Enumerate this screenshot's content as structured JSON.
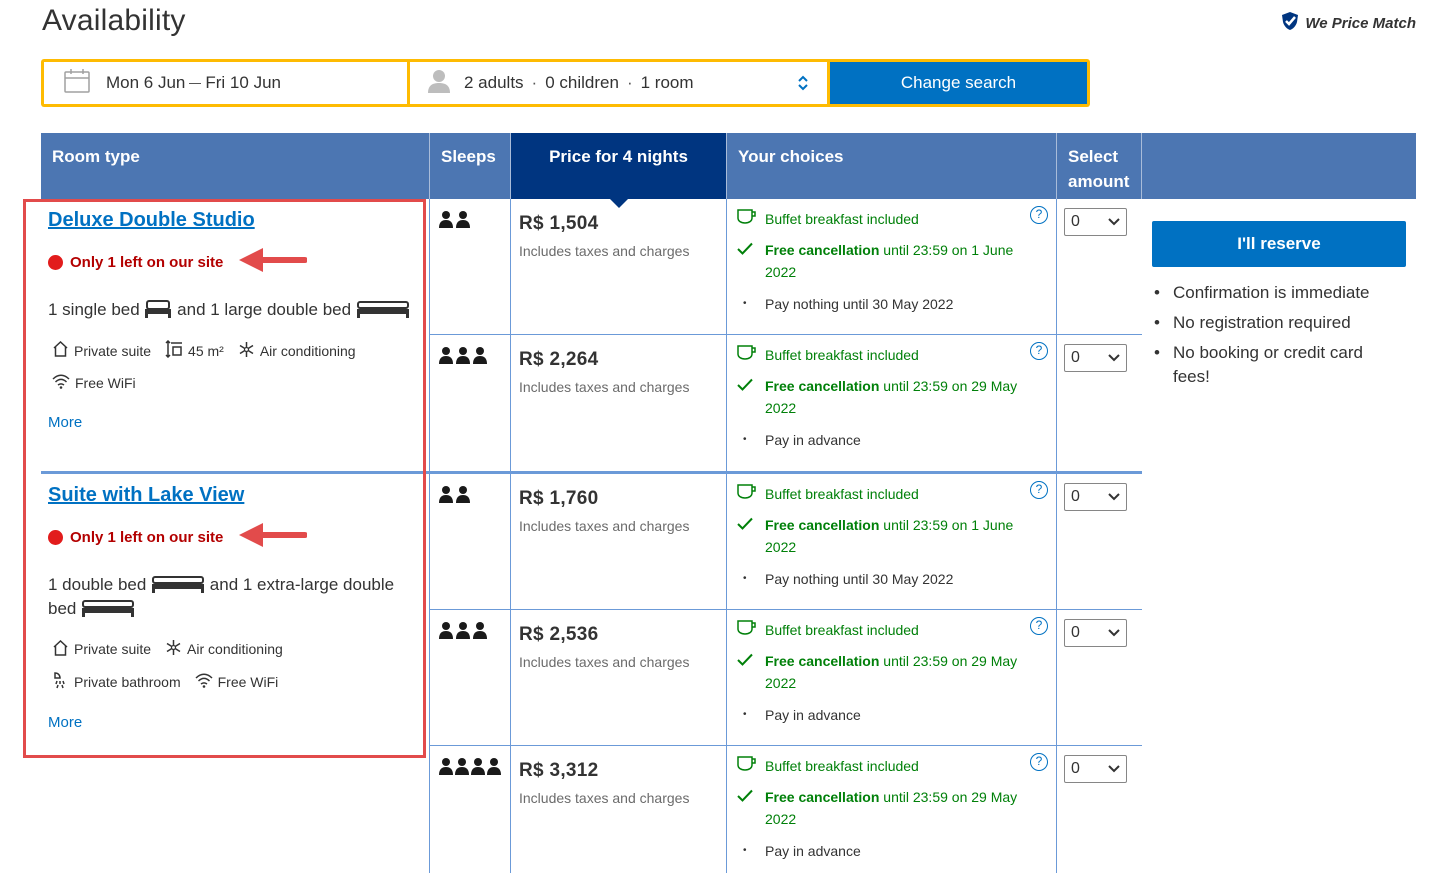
{
  "page": {
    "title": "Availability",
    "price_match": "We Price Match"
  },
  "search": {
    "date_from": "Mon 6 Jun",
    "date_to": "Fri 10 Jun",
    "adults": "2 adults",
    "children": "0 children",
    "rooms": "1 room",
    "separator": "·",
    "button": "Change search"
  },
  "table": {
    "headers": {
      "room_type": "Room type",
      "sleeps": "Sleeps",
      "price": "Price for 4 nights",
      "choices": "Your choices",
      "select_line1": "Select",
      "select_line2": "amount"
    },
    "rooms": [
      {
        "name": "Deluxe Double Studio",
        "scarcity": "Only 1 left on our site",
        "bed_part1": "1 single bed",
        "bed_part2": "and 1 large double bed",
        "facilities": [
          "Private suite",
          "45 m²",
          "Air conditioning",
          "Free WiFi"
        ],
        "more": "More",
        "options": [
          {
            "sleeps": 2,
            "price": "R$ 1,504",
            "price_note": "Includes taxes and charges",
            "breakfast": "Buffet breakfast included",
            "cancel_bold": "Free cancellation",
            "cancel_rest": "until 23:59 on 1 June 2022",
            "payment": "Pay nothing until 30 May 2022",
            "qty": "0"
          },
          {
            "sleeps": 3,
            "price": "R$ 2,264",
            "price_note": "Includes taxes and charges",
            "breakfast": "Buffet breakfast included",
            "cancel_bold": "Free cancellation",
            "cancel_rest": "until 23:59 on 29 May 2022",
            "payment": "Pay in advance",
            "qty": "0"
          }
        ]
      },
      {
        "name": "Suite with Lake View",
        "scarcity": "Only 1 left on our site",
        "bed_part1": "1 double bed",
        "bed_part2": "and 1 extra-large double bed",
        "facilities": [
          "Private suite",
          "Air conditioning",
          "Private bathroom",
          "Free WiFi"
        ],
        "more": "More",
        "options": [
          {
            "sleeps": 2,
            "price": "R$ 1,760",
            "price_note": "Includes taxes and charges",
            "breakfast": "Buffet breakfast included",
            "cancel_bold": "Free cancellation",
            "cancel_rest": "until 23:59 on 1 June 2022",
            "payment": "Pay nothing until 30 May 2022",
            "qty": "0"
          },
          {
            "sleeps": 3,
            "price": "R$ 2,536",
            "price_note": "Includes taxes and charges",
            "breakfast": "Buffet breakfast included",
            "cancel_bold": "Free cancellation",
            "cancel_rest": "until 23:59 on 29 May 2022",
            "payment": "Pay in advance",
            "qty": "0"
          },
          {
            "sleeps": 4,
            "price": "R$ 3,312",
            "price_note": "Includes taxes and charges",
            "breakfast": "Buffet breakfast included",
            "cancel_bold": "Free cancellation",
            "cancel_rest": "until 23:59 on 29 May 2022",
            "payment": "Pay in advance",
            "qty": "0"
          }
        ]
      }
    ]
  },
  "reserve": {
    "button": "I'll reserve",
    "benefits": [
      "Confirmation is immediate",
      "No registration required",
      "No booking or credit card fees!"
    ]
  },
  "colors": {
    "brand_blue": "#0071c2",
    "header_blue": "#4c76b2",
    "dark_blue": "#003580",
    "search_yellow": "#febb02",
    "green": "#008009",
    "alert_red": "#e24b4b"
  }
}
